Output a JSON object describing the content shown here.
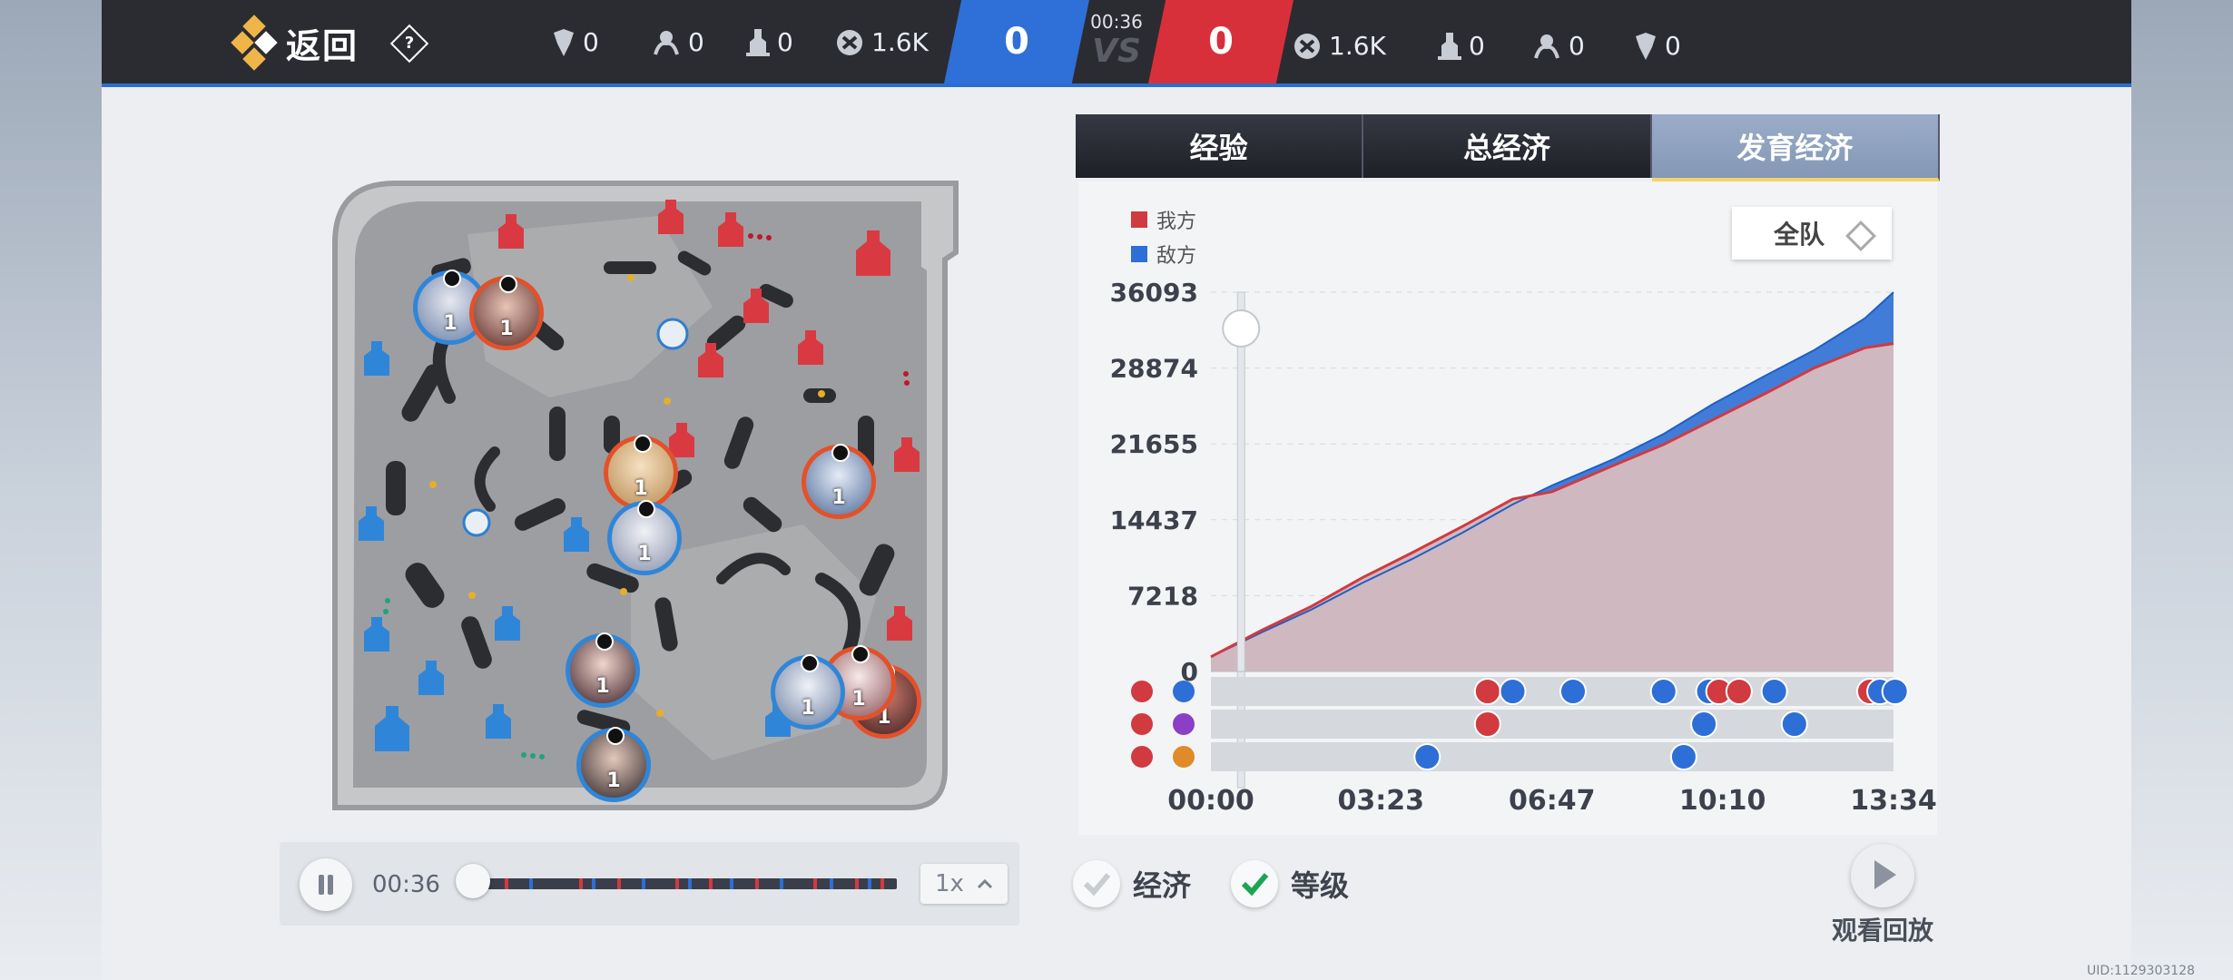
{
  "header": {
    "back_label": "返回",
    "help_symbol": "?",
    "match_time": "00:36",
    "vs_text": "VS",
    "blue_score": "0",
    "red_score": "0",
    "blue_stats": {
      "dragon": "0",
      "tyrant": "0",
      "tower": "0",
      "gold": "1.6K"
    },
    "red_stats": {
      "gold": "1.6K",
      "tower": "0",
      "tyrant": "0",
      "dragon": "0"
    }
  },
  "playback": {
    "time": "00:36",
    "speed": "1x",
    "progress": 0.0
  },
  "tabs": [
    "经验",
    "总经济",
    "发育经济"
  ],
  "active_tab": "发育经济",
  "team_select": "全队",
  "legend": {
    "ours": "我方",
    "enemy": "敌方",
    "ours_color": "#d13a3f",
    "enemy_color": "#2d6fd6"
  },
  "chart_data": {
    "type": "area",
    "x_ticks": [
      "00:00",
      "03:23",
      "06:47",
      "10:10",
      "13:34"
    ],
    "y_ticks": [
      "36093",
      "28874",
      "21655",
      "14437",
      "7218",
      "0"
    ],
    "ylim": [
      0,
      36093
    ],
    "series": [
      {
        "name": "我方",
        "color": "#d13a3f",
        "x_minutes": [
          0,
          1,
          2,
          3,
          4,
          5,
          6,
          6.78,
          8,
          9,
          10,
          11,
          12,
          13,
          13.57
        ],
        "values": [
          1400,
          3900,
          6200,
          8900,
          11300,
          13800,
          16400,
          17100,
          19600,
          21600,
          24000,
          26400,
          28900,
          30800,
          31200
        ]
      },
      {
        "name": "敌方",
        "color": "#2d6fd6",
        "x_minutes": [
          0,
          1,
          2,
          3,
          4,
          5,
          6,
          6.78,
          8,
          9,
          10,
          11,
          12,
          13,
          13.57
        ],
        "values": [
          1400,
          3700,
          5900,
          8400,
          10700,
          13200,
          15900,
          17700,
          20200,
          22600,
          25500,
          28100,
          30600,
          33600,
          36093
        ]
      }
    ]
  },
  "event_rows": [
    {
      "row": "towers",
      "our_icon": "red-tower-icon",
      "enemy_icon": "blue-tower-icon",
      "events": [
        {
          "t": 5.5,
          "team": "red"
        },
        {
          "t": 6.0,
          "team": "blue"
        },
        {
          "t": 7.2,
          "team": "blue"
        },
        {
          "t": 9.0,
          "team": "blue"
        },
        {
          "t": 9.9,
          "team": "blue"
        },
        {
          "t": 10.1,
          "team": "red"
        },
        {
          "t": 10.5,
          "team": "red"
        },
        {
          "t": 11.2,
          "team": "blue"
        },
        {
          "t": 13.1,
          "team": "red"
        },
        {
          "t": 13.3,
          "team": "blue"
        },
        {
          "t": 13.6,
          "team": "blue"
        }
      ]
    },
    {
      "row": "tyrant",
      "our_icon": "red-tyrant-icon",
      "enemy_icon": "purple-overlord-icon",
      "events": [
        {
          "t": 5.5,
          "team": "red"
        },
        {
          "t": 9.8,
          "team": "blue"
        },
        {
          "t": 11.6,
          "team": "blue"
        }
      ]
    },
    {
      "row": "dragon",
      "our_icon": "red-dragon-icon",
      "enemy_icon": "orange-dragon-icon",
      "events": [
        {
          "t": 4.3,
          "team": "blue"
        },
        {
          "t": 9.4,
          "team": "blue"
        }
      ]
    }
  ],
  "toggles": [
    {
      "label": "经济",
      "checked": false
    },
    {
      "label": "等级",
      "checked": true
    }
  ],
  "replay_label": "观看回放",
  "uid": "UID:1129303128",
  "map_heroes": [
    {
      "team": "blue",
      "level": "1"
    },
    {
      "team": "red",
      "level": "1"
    },
    {
      "team": "red",
      "level": "1"
    },
    {
      "team": "blue",
      "level": "1"
    },
    {
      "team": "red",
      "level": "1"
    },
    {
      "team": "blue",
      "level": "1"
    },
    {
      "team": "blue",
      "level": "1"
    },
    {
      "team": "red",
      "level": "1"
    },
    {
      "team": "red",
      "level": "1"
    },
    {
      "team": "blue",
      "level": "1"
    }
  ]
}
